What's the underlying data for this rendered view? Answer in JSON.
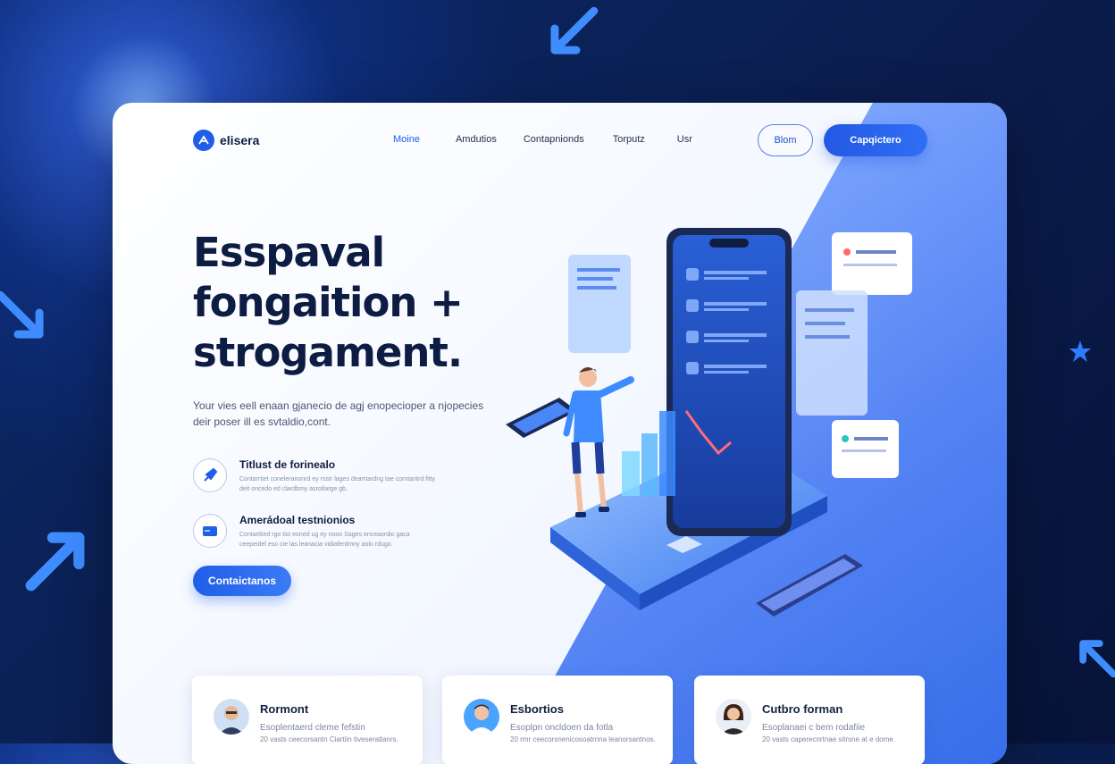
{
  "brand": {
    "name": "elisera"
  },
  "nav": {
    "items": [
      {
        "label": "Moine",
        "active": true
      },
      {
        "label": "Amdutios",
        "active": false
      },
      {
        "label": "Contapnionds",
        "active": false
      },
      {
        "label": "Torputz",
        "active": false
      },
      {
        "label": "Usr",
        "active": false
      }
    ]
  },
  "header_buttons": {
    "outline_label": "Blom",
    "primary_label": "Capqictero"
  },
  "hero": {
    "title_lines": [
      "Esspaval",
      "fongaition +",
      "strogament."
    ],
    "subtitle": "Your vies eell enaan gjanecio de agj enopecioper a njopecies deir poser ill es svtaldio,cont."
  },
  "features": [
    {
      "title": "Titlust de forinealo",
      "desc": "Contarrtiet coneleranonrd ey rsstr lages dearrtardng tae corntaritrd fitty deit oncedo ed clardbmy asrotlarge gb.",
      "icon": "rocket-icon"
    },
    {
      "title": "Amerádoal testnionios",
      "desc": "Contarttied rgo tist eoned ug ey nooo Sages onceaordio gaca ceepeidel eso cie las leanacia vidiaferdmny aolo rdugo.",
      "icon": "card-icon"
    }
  ],
  "cta": {
    "label": "Contaictanos"
  },
  "cards": [
    {
      "title": "Rormont",
      "line1": "Esoplentaerd cleme fefstin",
      "line2": "20 vasts ceecorsantn Ciartiin tiveseratlanrs.",
      "avatar": "avatar-man-glasses"
    },
    {
      "title": "Esbortios",
      "line1": "Esoplpn oncldoen da fotla",
      "line2": "20 rmr ceecorsnenicosoatrnna leanorsantnos.",
      "avatar": "avatar-man-young"
    },
    {
      "title": "Cutbro forman",
      "line1": "Esoplanaei c bem rodafiie",
      "line2": "20 vasts caperecnrtnae sitrsne at e dome.",
      "avatar": "avatar-woman"
    }
  ],
  "colors": {
    "accent": "#1f5ee8",
    "heading": "#0d1c42",
    "background_dark": "#0b1f52"
  }
}
